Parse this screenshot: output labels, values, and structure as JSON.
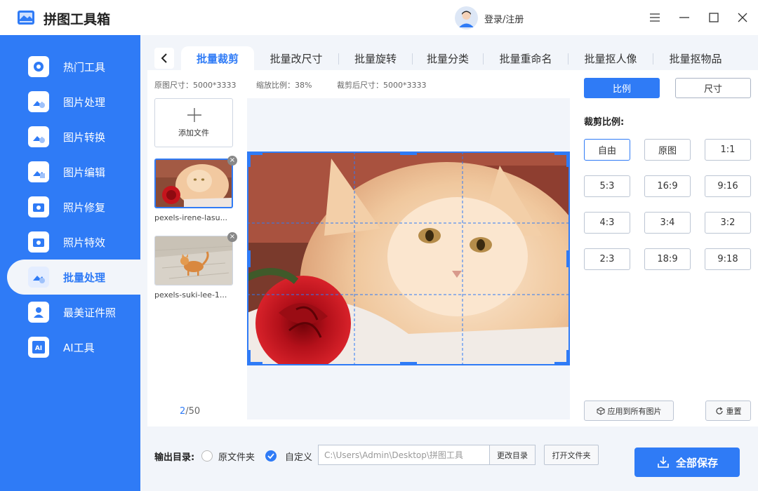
{
  "app": {
    "title": "拼图工具箱",
    "login": "登录/注册"
  },
  "sidebar": {
    "items": [
      {
        "label": "热门工具",
        "icon": "gear-icon"
      },
      {
        "label": "图片处理",
        "icon": "image-process-icon"
      },
      {
        "label": "图片转换",
        "icon": "image-convert-icon"
      },
      {
        "label": "图片编辑",
        "icon": "image-edit-icon"
      },
      {
        "label": "照片修复",
        "icon": "photo-repair-icon"
      },
      {
        "label": "照片特效",
        "icon": "photo-effect-icon"
      },
      {
        "label": "批量处理",
        "icon": "batch-icon"
      },
      {
        "label": "最美证件照",
        "icon": "id-photo-icon"
      },
      {
        "label": "AI工具",
        "icon": "ai-icon"
      }
    ]
  },
  "tabs": [
    "批量裁剪",
    "批量改尺寸",
    "批量旋转",
    "批量分类",
    "批量重命名",
    "批量抠人像",
    "批量抠物品"
  ],
  "info": {
    "original": "原图尺寸：5000*3333",
    "scale": "缩放比例：38%",
    "cropped": "裁剪后尺寸：5000*3333"
  },
  "files": {
    "add_label": "添加文件",
    "items": [
      {
        "name": "pexels-irene-lasu..."
      },
      {
        "name": "pexels-suki-lee-1..."
      }
    ],
    "pager_current": "2",
    "pager_total": "/50"
  },
  "crop": {
    "mode_ratio": "比例",
    "mode_size": "尺寸",
    "ratio_title": "裁剪比例:",
    "ratios": [
      "自由",
      "原图",
      "1:1",
      "5:3",
      "16:9",
      "9:16",
      "4:3",
      "3:4",
      "3:2",
      "2:3",
      "18:9",
      "9:18"
    ],
    "apply_all": "应用到所有图片",
    "reset": "重置"
  },
  "footer": {
    "label": "输出目录:",
    "opt_original": "原文件夹",
    "opt_custom": "自定义",
    "path": "C:\\Users\\Admin\\Desktop\\拼图工具",
    "change_dir": "更改目录",
    "open_dir": "打开文件夹",
    "save_all": "全部保存"
  },
  "colors": {
    "accent": "#2f7bf6",
    "sidebar": "#2f7bf6",
    "main_bg": "#f2f5fa"
  }
}
